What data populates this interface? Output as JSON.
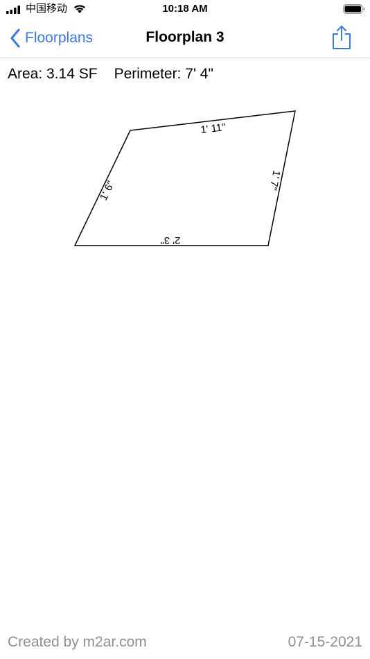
{
  "status_bar": {
    "carrier": "中国移动",
    "time": "10:18 AM"
  },
  "nav": {
    "back_label": "Floorplans",
    "title": "Floorplan 3"
  },
  "metrics": {
    "area": "Area: 3.14 SF",
    "perimeter": "Perimeter: 7' 4\""
  },
  "plan": {
    "edges": [
      {
        "name": "top-edge",
        "label": "1' 11\""
      },
      {
        "name": "right-edge",
        "label": "1' 7\""
      },
      {
        "name": "bottom-edge",
        "label": "2' 3\""
      },
      {
        "name": "left-edge",
        "label": "1' 6\""
      }
    ]
  },
  "footer": {
    "credit": "Created by m2ar.com",
    "date": "07-15-2021"
  },
  "colors": {
    "accent": "#3478f6",
    "footer_text": "#8e8e93",
    "separator": "#d9d9de"
  },
  "icons": [
    "signal-icon",
    "wifi-icon",
    "battery-icon",
    "chevron-left-icon",
    "share-icon"
  ]
}
